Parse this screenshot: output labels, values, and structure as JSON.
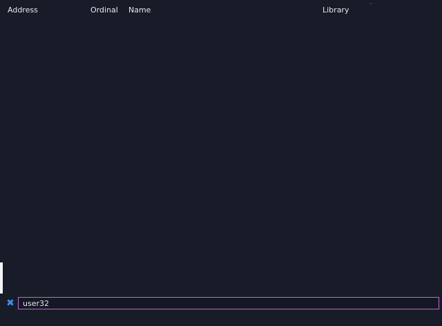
{
  "table": {
    "columns": {
      "address": "Address",
      "ordinal": "Ordinal",
      "name": "Name",
      "library": "Library"
    },
    "rows": []
  },
  "search": {
    "value": "user32",
    "clear_icon": "close-icon",
    "clear_glyph": "✖"
  },
  "colors": {
    "background": "#181c28",
    "accent": "#3d8bff",
    "input_border": "#c06ad4"
  }
}
